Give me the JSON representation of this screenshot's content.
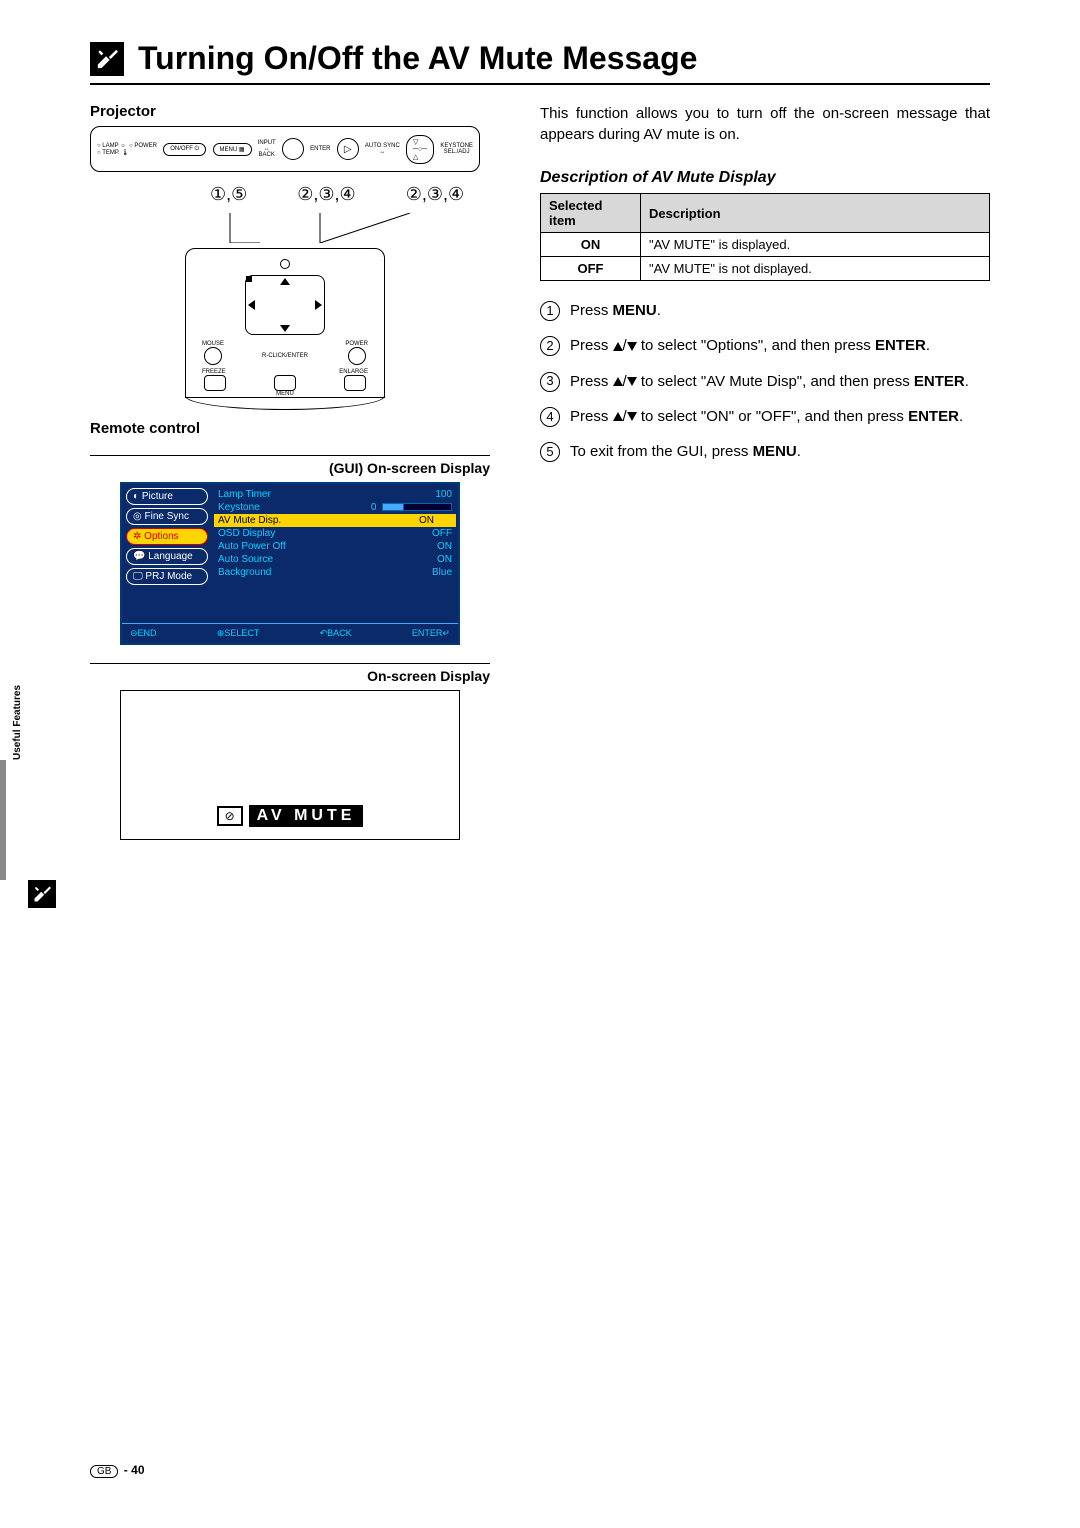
{
  "page": {
    "title": "Turning On/Off the AV Mute Message",
    "footer_region": "GB",
    "footer_page": "40"
  },
  "sidebar": {
    "label": "Useful Features"
  },
  "left": {
    "projector_label": "Projector",
    "remote_label": "Remote control",
    "gui_heading": "(GUI) On-screen Display",
    "osd_heading": "On-screen Display",
    "av_mute_label": "AV  MUTE",
    "callout_a": "①,⑤",
    "callout_b": "②,③,④",
    "callout_c": "②,③,④",
    "proj_labels": {
      "lamp": "LAMP",
      "power": "POWER",
      "temp": "TEMP.",
      "onoff": "ON/OFF",
      "menu": "MENU",
      "input": "INPUT",
      "back": "BACK",
      "enter": "ENTER",
      "autosync": "AUTO SYNC",
      "keystone": "KEYSTONE",
      "seladj": "SEL./ADJ"
    },
    "remote_labels": {
      "mouse": "MOUSE",
      "power": "POWER",
      "rclick": "R-CLICK/ENTER",
      "freeze": "FREEZE",
      "menu": "MENU",
      "enlarge": "ENLARGE"
    }
  },
  "gui": {
    "tabs": {
      "picture": "Picture",
      "finesync": "Fine Sync",
      "options": "Options",
      "language": "Language",
      "prjmode": "PRJ Mode"
    },
    "opts": {
      "lamp_timer_label": "Lamp Timer",
      "lamp_timer_val": "100",
      "keystone_label": "Keystone",
      "keystone_val": "0",
      "avmute_label": "AV Mute Disp.",
      "avmute_val": "ON",
      "osd_label": "OSD Display",
      "osd_val": "OFF",
      "autopoweroff_label": "Auto Power Off",
      "autopoweroff_val": "ON",
      "autosource_label": "Auto Source",
      "autosource_val": "ON",
      "background_label": "Background",
      "background_val": "Blue"
    },
    "footer": {
      "end": "⊖END",
      "select": "⊕SELECT",
      "back": "↶BACK",
      "enter": "ENTER↵"
    }
  },
  "right": {
    "intro": "This function allows you to turn off the on-screen message that appears during AV mute is on.",
    "desc_heading": "Description of AV Mute Display",
    "table": {
      "h1": "Selected item",
      "h2": "Description",
      "r1c1": "ON",
      "r1c2": "\"AV MUTE\" is displayed.",
      "r2c1": "OFF",
      "r2c2": "\"AV MUTE\" is not displayed."
    },
    "steps": {
      "s1": {
        "n": "1",
        "pre": "Press ",
        "bold": "MENU",
        "post": "."
      },
      "s2": {
        "n": "2",
        "pre": "Press ",
        "mid": " to select \"Options\", and then press ",
        "bold": "ENTER",
        "post": "."
      },
      "s3": {
        "n": "3",
        "pre": "Press ",
        "mid": " to select \"AV Mute Disp\", and then press ",
        "bold": "ENTER",
        "post": "."
      },
      "s4": {
        "n": "4",
        "pre": "Press ",
        "mid": " to select \"ON\" or \"OFF\", and then press ",
        "bold": "ENTER",
        "post": "."
      },
      "s5": {
        "n": "5",
        "pre": "To exit from the GUI, press ",
        "bold": "MENU",
        "post": "."
      }
    }
  }
}
